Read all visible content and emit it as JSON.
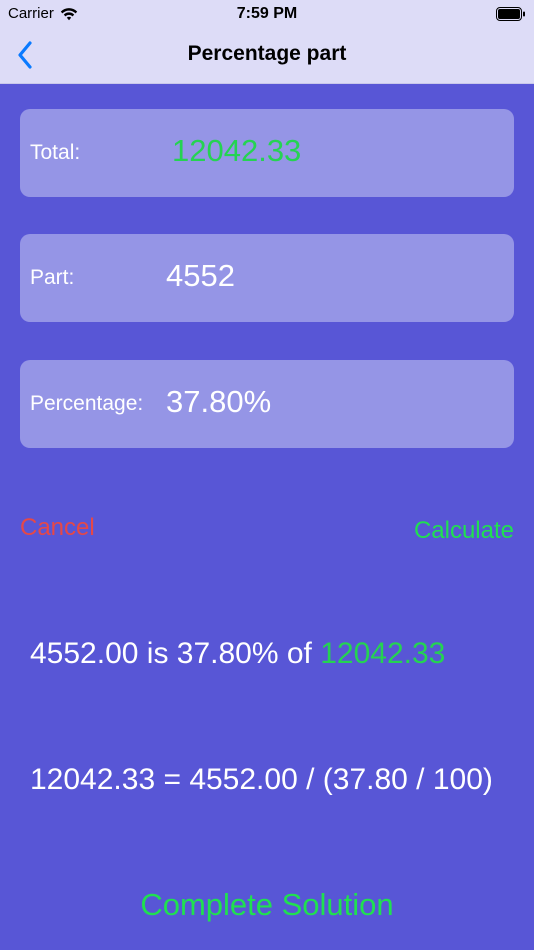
{
  "status_bar": {
    "carrier": "Carrier",
    "time": "7:59 PM",
    "wifi_icon": "wifi-icon",
    "battery_icon": "battery-icon"
  },
  "nav": {
    "title": "Percentage part",
    "back_icon": "chevron-left-icon"
  },
  "fields": {
    "total": {
      "label": "Total:",
      "value": "12042.33"
    },
    "part": {
      "label": "Part:",
      "value": "4552"
    },
    "percentage": {
      "label": "Percentage:",
      "value": "37.80%"
    }
  },
  "actions": {
    "cancel_label": "Cancel",
    "calculate_label": "Calculate",
    "complete_solution_label": "Complete Solution"
  },
  "results": {
    "line1_prefix": "4552.00 is 37.80% of ",
    "line1_highlight": "12042.33",
    "line2": "12042.33 = 4552.00 / (37.80 / 100)"
  },
  "colors": {
    "background": "#5856d6",
    "card": "#9595e6",
    "nav_bg": "#dddcf7",
    "accent_green": "#25d352",
    "cancel_red": "#e54848",
    "ios_blue": "#0a7aff"
  }
}
